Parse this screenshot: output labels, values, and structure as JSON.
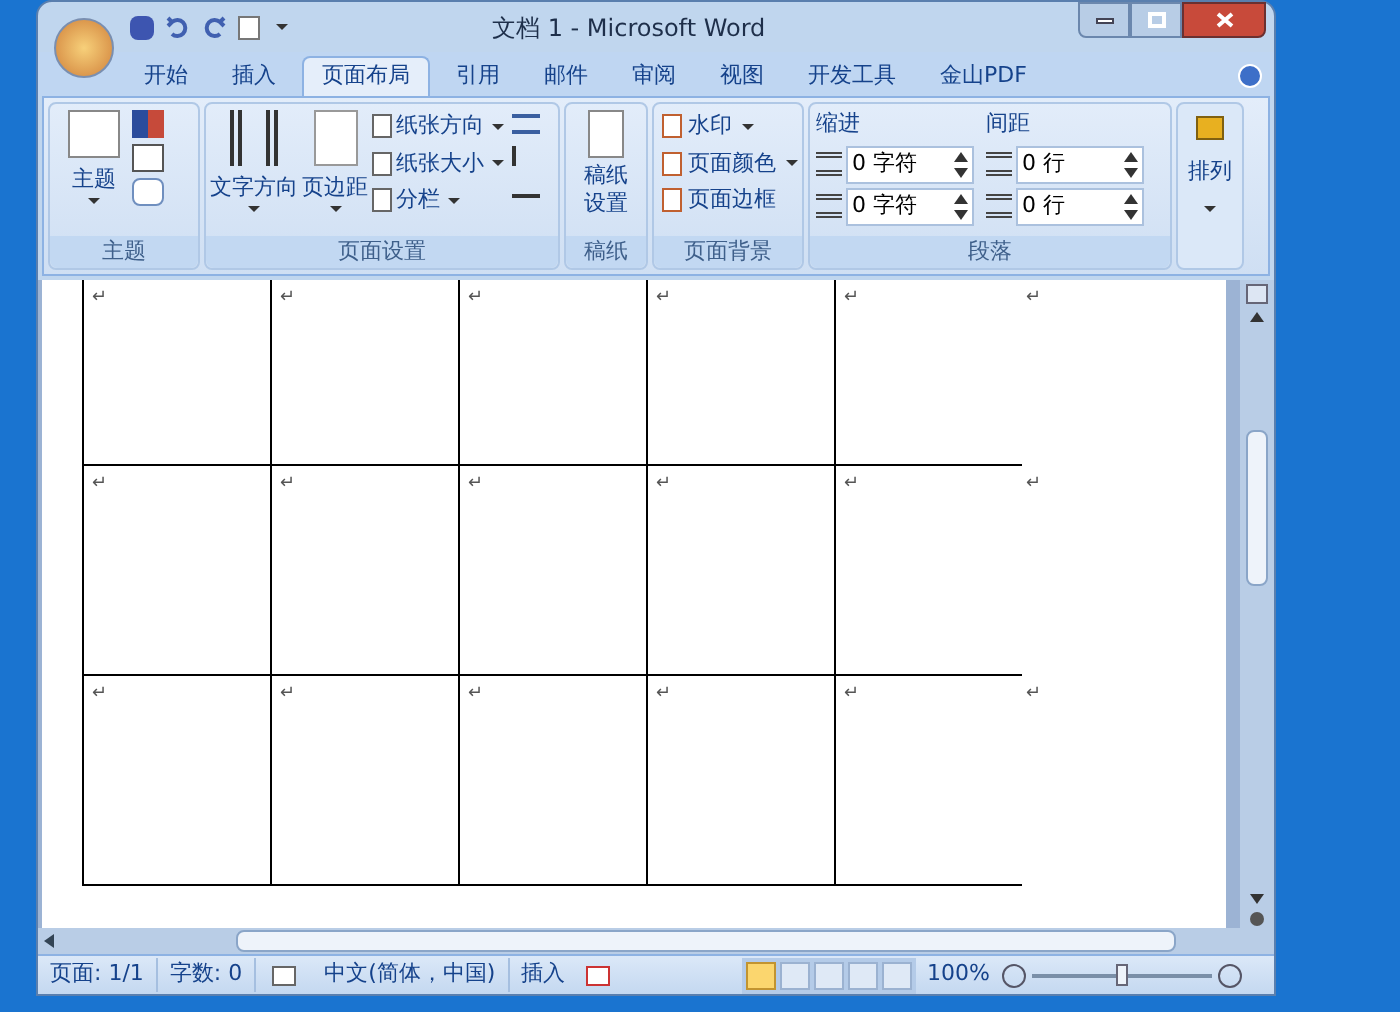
{
  "window": {
    "title": "文档 1 - Microsoft Word"
  },
  "tabs": [
    {
      "label": "开始",
      "selected": false
    },
    {
      "label": "插入",
      "selected": false
    },
    {
      "label": "页面布局",
      "selected": true
    },
    {
      "label": "引用",
      "selected": false
    },
    {
      "label": "邮件",
      "selected": false
    },
    {
      "label": "审阅",
      "selected": false
    },
    {
      "label": "视图",
      "selected": false
    },
    {
      "label": "开发工具",
      "selected": false
    },
    {
      "label": "金山PDF",
      "selected": false
    }
  ],
  "ribbon": {
    "theme": {
      "button": "主题",
      "title": "主题"
    },
    "page_setup": {
      "big_buttons": [
        "文字方向",
        "页边距"
      ],
      "small_buttons": [
        "纸张方向",
        "纸张大小",
        "分栏"
      ],
      "title": "页面设置"
    },
    "manuscript": {
      "button": "稿纸设置",
      "title": "稿纸"
    },
    "page_background": {
      "items": [
        "水印",
        "页面颜色",
        "页面边框"
      ],
      "title": "页面背景"
    },
    "paragraph": {
      "indent_label": "缩进",
      "indent_values": [
        "0 字符",
        "0 字符"
      ],
      "spacing_label": "间距",
      "spacing_values": [
        "0 行",
        "0 行"
      ],
      "title": "段落"
    },
    "arrange": {
      "button": "排列"
    }
  },
  "document": {
    "rows": [
      {
        "cells": [
          "↵",
          "↵",
          "↵",
          "↵",
          "↵"
        ],
        "end_mark": "↵"
      },
      {
        "cells": [
          "↵",
          "↵",
          "↵",
          "↵",
          "↵"
        ],
        "end_mark": "↵"
      },
      {
        "cells": [
          "↵",
          "↵",
          "↵",
          "↵",
          "↵"
        ],
        "end_mark": "↵"
      }
    ]
  },
  "status_bar": {
    "items": [
      "页面: 1/1",
      "字数: 0"
    ],
    "language": "中文(简体，中国)",
    "mode": "插入",
    "views": [
      {
        "selected": true
      },
      {
        "selected": false
      },
      {
        "selected": false
      },
      {
        "selected": false
      },
      {
        "selected": false
      }
    ],
    "zoom": "100%",
    "zoom_slider": {
      "level": 0.5
    }
  }
}
